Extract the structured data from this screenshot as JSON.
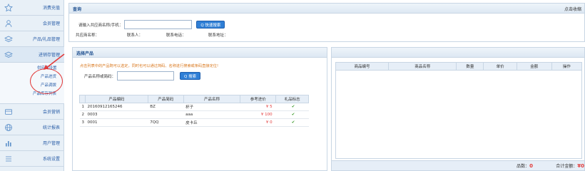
{
  "sidebar": {
    "items": [
      {
        "label": "消费充值",
        "icon": "star-icon"
      },
      {
        "label": "会员管理",
        "icon": "user-icon"
      },
      {
        "label": "产品/礼品管理",
        "icon": "layers-icon"
      },
      {
        "label": "进销存管理",
        "icon": "layers-icon"
      },
      {
        "label": "会员营销",
        "icon": "card-icon"
      },
      {
        "label": "统计报表",
        "icon": "globe-icon"
      },
      {
        "label": "用户管理",
        "icon": "bar-chart-icon"
      },
      {
        "label": "系统设置",
        "icon": "list-icon"
      }
    ],
    "sub_items": [
      "供应商设置",
      "产品进货",
      "产品调拨",
      "产品库存列表"
    ]
  },
  "query_panel": {
    "title": "查询",
    "right_text": "点击收缩",
    "search_label": "请输入共应商名称/手机：",
    "search_value": "",
    "search_button": "Q 快速搜索",
    "fields": [
      "共应商名称：",
      "联系人：",
      "联系电话：",
      "联系地址："
    ]
  },
  "select_panel": {
    "title": "选择产品",
    "hint": "点击列表中的产品既可以选定，同时也可以通过简码、名称进行搜索或条码直接定位!",
    "name_label": "产品名称或简码：",
    "name_value": "",
    "search_button": "Q 搜索",
    "columns": [
      "产品编码",
      "产品简码",
      "产品名称",
      "参考进价",
      "礼品标志"
    ],
    "rows": [
      {
        "idx": "1",
        "code": "20160912165246",
        "short": "BZ",
        "name": "杯子",
        "price": "¥ 5",
        "gift": "✔"
      },
      {
        "idx": "2",
        "code": "0003",
        "short": "",
        "name": "aaa",
        "price": "¥ 100",
        "gift": "✔"
      },
      {
        "idx": "3",
        "code": "0001",
        "short": "7QQ",
        "name": "皮卡丘",
        "price": "¥ 0",
        "gift": "✔"
      }
    ]
  },
  "order_panel": {
    "columns": [
      "商品编号",
      "商品名称",
      "数量",
      "单价",
      "金额",
      "操作"
    ],
    "footer_count_label": "品数：",
    "footer_count": "0",
    "footer_total_label": "合计金额：",
    "footer_total": "¥0"
  },
  "colors": {
    "accent": "#2f7fd6",
    "price": "#e23a3a",
    "hint": "#d9771c",
    "check": "#3a9a2a"
  }
}
